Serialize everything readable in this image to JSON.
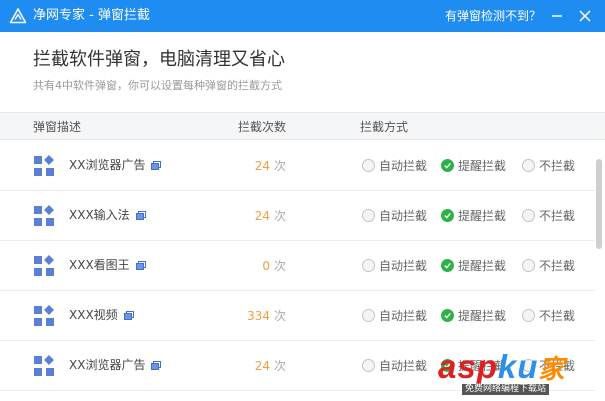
{
  "window": {
    "title": "净网专家 - 弹窗拦截",
    "help_link": "有弹窗检测不到？",
    "min_icon": "minimize-icon",
    "close_icon": "close-icon"
  },
  "header": {
    "headline": "拦截软件弹窗，电脑清理又省心",
    "subline": "共有4中软件弹窗，你可以设置每种弹窗的拦截方式"
  },
  "table": {
    "columns": [
      "弹窗描述",
      "拦截次数",
      "拦截方式"
    ],
    "unit": "次",
    "options": [
      "自动拦截",
      "提醒拦截",
      "不拦截"
    ],
    "rows": [
      {
        "name": "XX浏览器广告",
        "count": "24",
        "selected": 1
      },
      {
        "name": "XXX输入法",
        "count": "24",
        "selected": 1
      },
      {
        "name": "XXX看图王",
        "count": "0",
        "selected": 1
      },
      {
        "name": "XXX视频",
        "count": "334",
        "selected": 1
      },
      {
        "name": "XX浏览器广告",
        "count": "24",
        "selected": 1
      }
    ]
  },
  "watermark": {
    "brand_a": "asp",
    "brand_b": "ku",
    "brand_c": "家",
    "sub": "免费网络编程下载站"
  },
  "colors": {
    "titlebar": "#1e8cf0",
    "accent_count": "#f0a040",
    "radio_checked": "#2fb14a"
  }
}
